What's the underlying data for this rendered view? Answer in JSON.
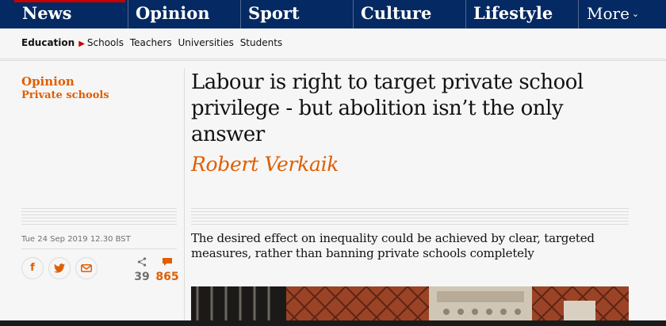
{
  "nav": {
    "pillars": [
      {
        "label": "News",
        "accent": "#c70000"
      },
      {
        "label": "Opinion",
        "accent": "#e05e00"
      },
      {
        "label": "Sport",
        "accent": "#0084c6"
      },
      {
        "label": "Culture",
        "accent": "#a1845c"
      },
      {
        "label": "Lifestyle",
        "accent": "#bb3b80"
      }
    ],
    "more_label": "More"
  },
  "subnav": {
    "section": "Education",
    "links": [
      "Schools",
      "Teachers",
      "Universities",
      "Students"
    ]
  },
  "article": {
    "kicker": "Opinion",
    "series": "Private schools",
    "headline": "Labour is right to target private school privilege - but abolition isn’t the only answer",
    "byline": "Robert Verkaik",
    "date": "Tue 24 Sep 2019 12.30 BST",
    "standfirst": "The desired effect on inequality could be achieved by clear, targeted measures, rather than banning private schools completely",
    "share_count": "39",
    "comment_count": "865"
  },
  "colors": {
    "brand_blue": "#052962",
    "opinion_orange": "#e05e00",
    "news_red": "#c70000"
  },
  "icons": {
    "share": [
      "facebook-icon",
      "twitter-icon",
      "email-icon"
    ],
    "share_count_icon": "share-icon",
    "comment_count_icon": "comment-icon"
  }
}
